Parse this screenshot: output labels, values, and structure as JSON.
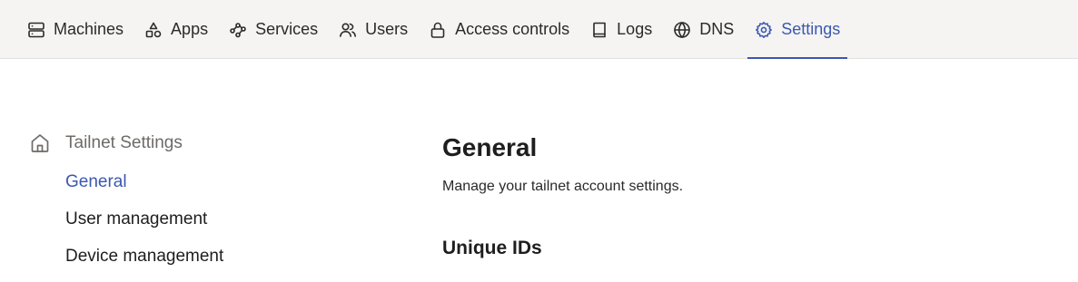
{
  "nav": {
    "tabs": [
      {
        "label": "Machines",
        "icon": "server-icon"
      },
      {
        "label": "Apps",
        "icon": "shapes-icon"
      },
      {
        "label": "Services",
        "icon": "services-icon"
      },
      {
        "label": "Users",
        "icon": "users-icon"
      },
      {
        "label": "Access controls",
        "icon": "lock-icon"
      },
      {
        "label": "Logs",
        "icon": "book-icon"
      },
      {
        "label": "DNS",
        "icon": "globe-icon"
      },
      {
        "label": "Settings",
        "icon": "gear-icon"
      }
    ],
    "active_tab": "Settings"
  },
  "sidebar": {
    "header": "Tailnet Settings",
    "header_icon": "home-icon",
    "items": [
      {
        "label": "General",
        "active": true
      },
      {
        "label": "User management",
        "active": false
      },
      {
        "label": "Device management",
        "active": false
      }
    ]
  },
  "main": {
    "title": "General",
    "description": "Manage your tailnet account settings.",
    "section_title": "Unique IDs"
  },
  "colors": {
    "accent": "#3b58b0",
    "nav_background": "#f5f4f3",
    "text": "#1f1e1e",
    "muted": "#6d6a67"
  }
}
